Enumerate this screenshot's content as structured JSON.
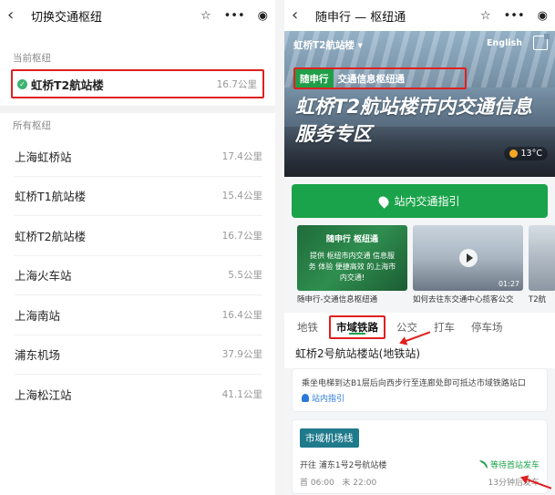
{
  "left": {
    "title": "切换交通枢纽",
    "current_label": "当前枢纽",
    "current": {
      "name": "虹桥T2航站楼",
      "dist": "16.7公里"
    },
    "all_label": "所有枢纽",
    "hubs": [
      {
        "name": "上海虹桥站",
        "dist": "17.4公里"
      },
      {
        "name": "虹桥T1航站楼",
        "dist": "15.4公里"
      },
      {
        "name": "虹桥T2航站楼",
        "dist": "16.7公里"
      },
      {
        "name": "上海火车站",
        "dist": "5.5公里"
      },
      {
        "name": "上海南站",
        "dist": "16.4公里"
      },
      {
        "name": "浦东机场",
        "dist": "37.9公里"
      },
      {
        "name": "上海松江站",
        "dist": "41.1公里"
      }
    ]
  },
  "right": {
    "title": "随申行 — 枢纽通",
    "hero": {
      "station": "虹桥T2航站楼 ▾",
      "english": "English",
      "brand": "随申行",
      "sub": "交通信息枢纽通",
      "headline": "虹桥T2航站楼市内交通信息服务专区",
      "weather": "13°C"
    },
    "guide_button": "站内交通指引",
    "cards": [
      {
        "t1": "随申行 枢纽通",
        "t2": "提供 枢纽市内交通 信息服务 体验 便捷高效 的上海市内交通!",
        "caption": "随申行-交通信息枢纽通"
      },
      {
        "duration": "01:27",
        "caption": "如何去往东交通中心揽客公交"
      },
      {
        "caption": "T2航"
      }
    ],
    "tabs": [
      "地铁",
      "市域铁路",
      "公交",
      "打车",
      "停车场"
    ],
    "active_tab": "市域铁路",
    "metro_station": "虹桥2号航站楼站(地铁站)",
    "info": {
      "text": "乘坐电梯到达B1层后向西步行至连廊处即可抵达市域铁路站口",
      "link": "站内指引"
    },
    "line": {
      "badge": "市域机场线",
      "direction": "开往 浦东1号2号航站楼",
      "wait": "等待首站发车",
      "first": "首 06:00",
      "last": "末 22:00",
      "eta": "13分钟后发车"
    }
  },
  "colors": {
    "accent_green": "#1aa34a",
    "highlight_red": "#e02020",
    "line_badge": "#1f7a8c"
  }
}
